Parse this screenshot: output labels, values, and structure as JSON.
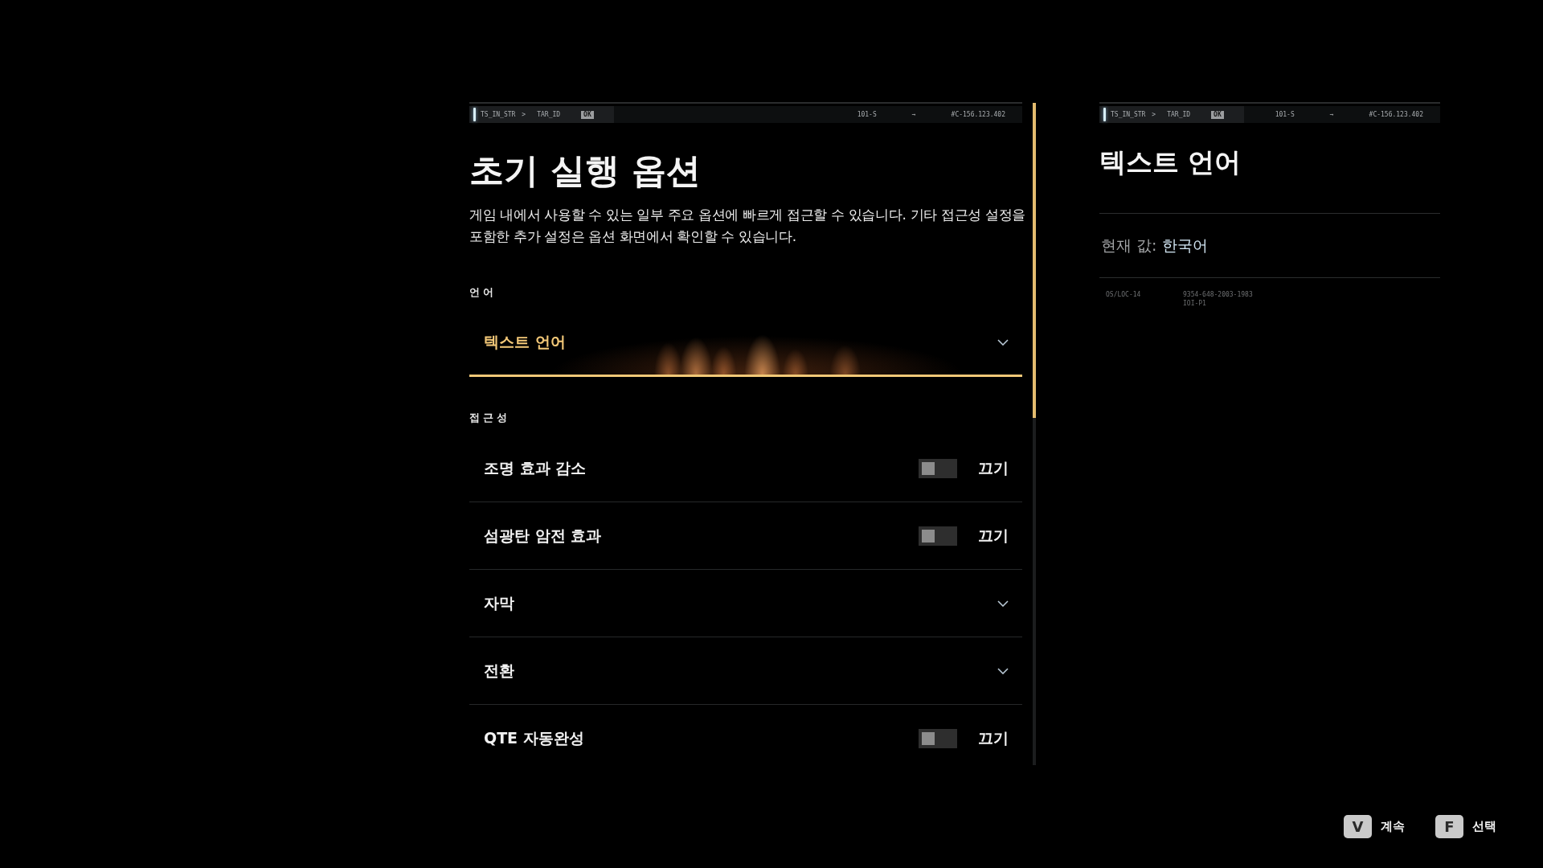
{
  "main_panel": {
    "header_bar": {
      "source": "TS_IN_STR",
      "separator": ">",
      "target": "TAR_ID",
      "status": "OK",
      "code": "101-S",
      "arrow": "→",
      "address": "#C-156.123.402"
    },
    "title": "초기 실행 옵션",
    "description": "게임 내에서 사용할 수 있는 일부 주요 옵션에 빠르게 접근할 수 있습니다. 기타 접근성 설정을 포함한 추가 설정은 옵션 화면에서 확인할 수 있습니다.",
    "sections": [
      {
        "label": "언어",
        "items": [
          {
            "kind": "dropdown",
            "label": "텍스트 언어",
            "selected": true
          }
        ]
      },
      {
        "label": "접근성",
        "items": [
          {
            "kind": "toggle",
            "label": "조명 효과 감소",
            "selected": false,
            "on": false,
            "value": "끄기"
          },
          {
            "kind": "toggle",
            "label": "섬광탄 암전 효과",
            "selected": false,
            "on": false,
            "value": "끄기"
          },
          {
            "kind": "dropdown",
            "label": "자막",
            "selected": false
          },
          {
            "kind": "dropdown",
            "label": "전환",
            "selected": false
          },
          {
            "kind": "toggle",
            "label": "QTE 자동완성",
            "selected": false,
            "on": false,
            "value": "끄기"
          }
        ]
      }
    ]
  },
  "detail_panel": {
    "header_bar": {
      "source": "TS_IN_STR",
      "separator": ">",
      "target": "TAR_ID",
      "status": "OK",
      "code": "101-S",
      "arrow": "→",
      "address": "#C-156.123.402"
    },
    "title": "텍스트 언어",
    "current_value": {
      "label": "현재 값:",
      "value": "한국어"
    },
    "footer": {
      "code": "OS/LOC-14",
      "serial": "9354-648-2003-1983",
      "sub_code": "IOI-P1"
    }
  },
  "key_hints": [
    {
      "key": "V",
      "label": "계속"
    },
    {
      "key": "F",
      "label": "선택"
    }
  ]
}
